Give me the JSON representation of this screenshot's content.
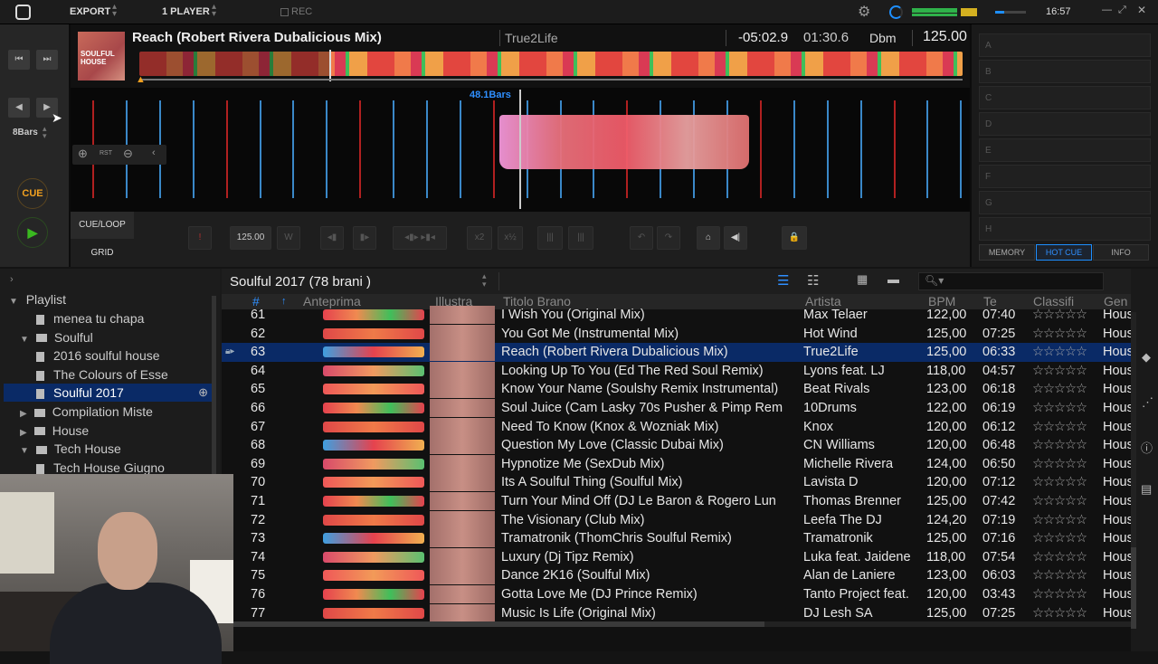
{
  "topbar": {
    "export": "EXPORT",
    "player_mode": "1 PLAYER",
    "rec": "REC",
    "clock": "16:57"
  },
  "deck": {
    "title": "Reach (Robert Rivera Dubalicious Mix)",
    "artist": "True2Life",
    "remaining": "-05:02.9",
    "elapsed": "01:30.6",
    "key": "Dbm",
    "bpm": "125.00",
    "bars_marker": "48.1Bars",
    "beat_jump": "8Bars",
    "cue": "CUE",
    "cue_loop": "CUE/LOOP",
    "grid": "GRID",
    "rst": "RST",
    "grid_bpm": "125.00",
    "x2": "x2",
    "x_half": "x½",
    "art_text": "SOULFUL HOUSE"
  },
  "hotcue": {
    "slots": [
      "A",
      "B",
      "C",
      "D",
      "E",
      "F",
      "G",
      "H"
    ],
    "tabs": [
      "MEMORY",
      "HOT CUE",
      "INFO"
    ],
    "active_tab": "HOT CUE"
  },
  "tree": {
    "root": "Playlist",
    "items": [
      {
        "label": "menea tu chapa",
        "depth": 2,
        "type": "list"
      },
      {
        "label": "Soulful",
        "depth": 1,
        "type": "folder",
        "open": true
      },
      {
        "label": "2016 soulful house",
        "depth": 2,
        "type": "list"
      },
      {
        "label": "The Colours of Esse",
        "depth": 2,
        "type": "list"
      },
      {
        "label": "Soulful 2017",
        "depth": 2,
        "type": "list",
        "selected": true
      },
      {
        "label": "Compilation Miste",
        "depth": 1,
        "type": "folder",
        "open": false
      },
      {
        "label": "House",
        "depth": 1,
        "type": "folder",
        "open": false
      },
      {
        "label": "Tech House",
        "depth": 1,
        "type": "folder",
        "open": true
      },
      {
        "label": "Tech House Giugno",
        "depth": 2,
        "type": "list"
      }
    ]
  },
  "list": {
    "title": "Soulful 2017 (78 brani )",
    "columns": [
      "#",
      "Anteprima",
      "Illustra",
      "Titolo Brano",
      "Artista",
      "BPM",
      "Te",
      "Classifi",
      "Gen"
    ],
    "genre": "House",
    "stars": "☆☆☆☆☆",
    "selected_no": "63",
    "rows": [
      {
        "no": "61",
        "title": "I Wish You (Original Mix)",
        "artist": "Max Telaer",
        "bpm": "122,00",
        "time": "07:40"
      },
      {
        "no": "62",
        "title": "You Got Me (Instrumental Mix)",
        "artist": "Hot Wind",
        "bpm": "125,00",
        "time": "07:25"
      },
      {
        "no": "63",
        "title": "Reach (Robert Rivera Dubalicious Mix)",
        "artist": "True2Life",
        "bpm": "125,00",
        "time": "06:33"
      },
      {
        "no": "64",
        "title": "Looking Up To You (Ed The Red Soul Remix)",
        "artist": "Lyons feat. LJ",
        "bpm": "118,00",
        "time": "04:57"
      },
      {
        "no": "65",
        "title": "Know Your Name (Soulshy Remix Instrumental)",
        "artist": "Beat Rivals",
        "bpm": "123,00",
        "time": "06:18"
      },
      {
        "no": "66",
        "title": "Soul Juice (Cam Lasky 70s Pusher & Pimp Rem",
        "artist": "10Drums",
        "bpm": "122,00",
        "time": "06:19"
      },
      {
        "no": "67",
        "title": "Need To Know (Knox & Wozniak Mix)",
        "artist": "Knox",
        "bpm": "120,00",
        "time": "06:12"
      },
      {
        "no": "68",
        "title": "Question My Love (Classic Dubai Mix)",
        "artist": "CN Williams",
        "bpm": "120,00",
        "time": "06:48"
      },
      {
        "no": "69",
        "title": "Hypnotize Me (SexDub Mix)",
        "artist": "Michelle Rivera",
        "bpm": "124,00",
        "time": "06:50"
      },
      {
        "no": "70",
        "title": "Its A Soulful Thing (Soulful Mix)",
        "artist": "Lavista D",
        "bpm": "120,00",
        "time": "07:12"
      },
      {
        "no": "71",
        "title": "Turn Your Mind Off (DJ Le Baron & Rogero Lun",
        "artist": "Thomas Brenner",
        "bpm": "125,00",
        "time": "07:42"
      },
      {
        "no": "72",
        "title": "The Visionary (Club Mix)",
        "artist": "Leefa The DJ",
        "bpm": "124,20",
        "time": "07:19"
      },
      {
        "no": "73",
        "title": "Tramatronik (ThomChris Soulful Remix)",
        "artist": "Tramatronik",
        "bpm": "125,00",
        "time": "07:16"
      },
      {
        "no": "74",
        "title": "Luxury (Dj Tipz Remix)",
        "artist": "Luka feat. Jaidene",
        "bpm": "118,00",
        "time": "07:54"
      },
      {
        "no": "75",
        "title": "Dance 2K16 (Soulful Mix)",
        "artist": "Alan de Laniere",
        "bpm": "123,00",
        "time": "06:03"
      },
      {
        "no": "76",
        "title": "Gotta Love Me (DJ Prince Remix)",
        "artist": "Tanto Project feat.",
        "bpm": "120,00",
        "time": "03:43"
      },
      {
        "no": "77",
        "title": "Music Is Life (Original Mix)",
        "artist": "DJ Lesh SA",
        "bpm": "125,00",
        "time": "07:25"
      }
    ]
  },
  "colors": {
    "accent": "#1e8fff",
    "cue": "#f0a020",
    "play": "#3ab820",
    "selection": "#0a2a66",
    "beat_red": "#b02020",
    "beat_blue": "#3a88c8"
  }
}
